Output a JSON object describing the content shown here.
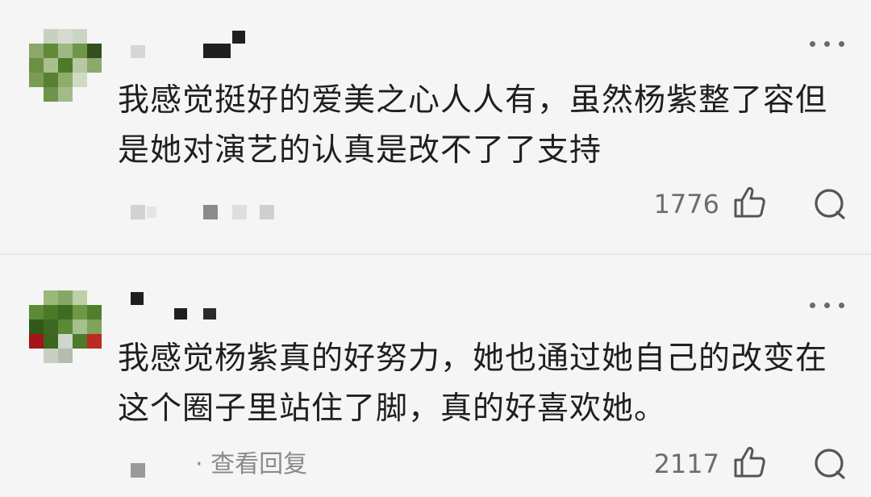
{
  "comments": [
    {
      "text": "我感觉挺好的爱美之心人人有，虽然杨紫整了容但是她对演艺的认真是改不了了支持",
      "likes": "1776",
      "more_icon": "more-dots-icon",
      "like_icon": "thumbs-up-icon",
      "comment_icon": "speech-bubble-icon"
    },
    {
      "text": "我感觉杨紫真的好努力，她也通过她自己的改变在这个圈子里站住了脚，真的好喜欢她。",
      "reply_link": "· 查看回复",
      "likes": "2117",
      "more_icon": "more-dots-icon",
      "like_icon": "thumbs-up-icon",
      "comment_icon": "speech-bubble-icon"
    }
  ],
  "colors": {
    "background": "#f5f5f5",
    "text": "#1f1f1f",
    "muted": "#8a8a8a",
    "divider": "#e8e8e8"
  }
}
